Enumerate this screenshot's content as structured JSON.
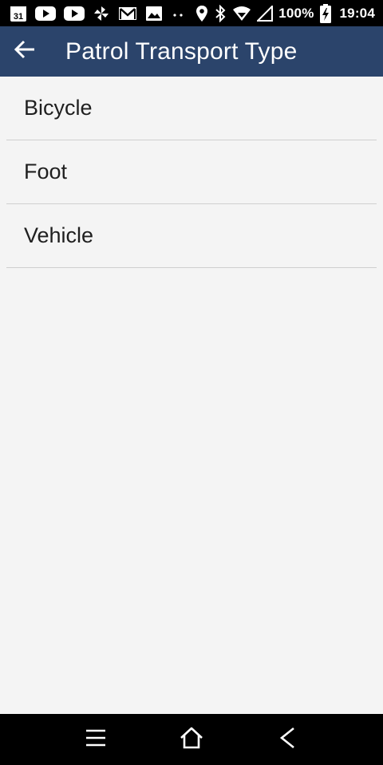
{
  "status_bar": {
    "left_icons": [
      "calendar-icon",
      "youtube-icon",
      "youtube-icon",
      "pinwheel-icon",
      "gmail-icon",
      "photos-icon",
      "more-dots-icon"
    ],
    "calendar_day": "31",
    "right_icons": [
      "location-icon",
      "bluetooth-icon",
      "wifi-icon",
      "signal-icon",
      "battery-charging-icon"
    ],
    "battery": "100%",
    "time": "19:04"
  },
  "app_bar": {
    "back_icon": "arrow-back-icon",
    "title": "Patrol Transport Type",
    "background": "#2b446b"
  },
  "list": {
    "items": [
      {
        "label": "Bicycle"
      },
      {
        "label": "Foot"
      },
      {
        "label": "Vehicle"
      }
    ]
  },
  "nav_bar": {
    "buttons": [
      "menu-icon",
      "home-icon",
      "back-chevron-icon"
    ]
  }
}
